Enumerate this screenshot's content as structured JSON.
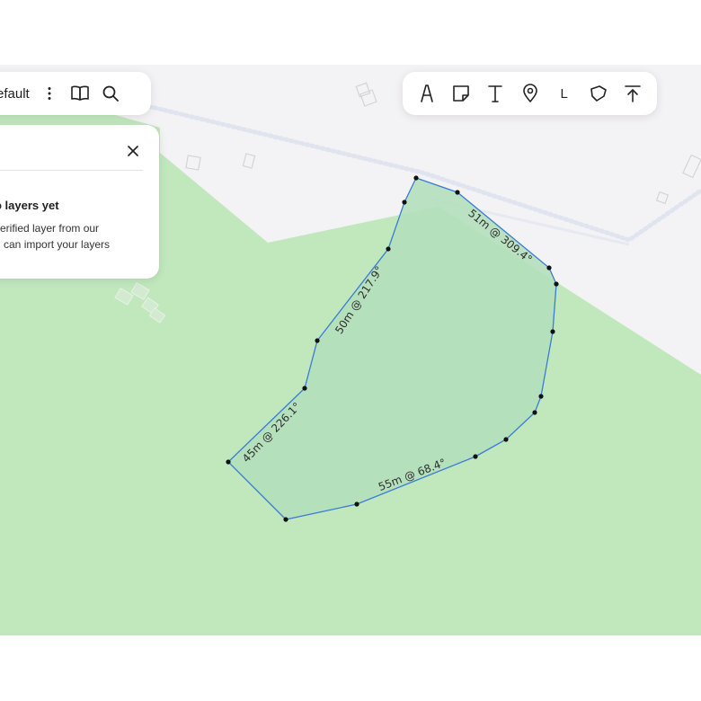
{
  "layer_toolbar": {
    "layer_name": "efault",
    "icons": [
      "more-vertical-icon",
      "book-open-icon",
      "search-icon"
    ]
  },
  "draw_toolbar": {
    "tools": [
      {
        "name": "text-tool-icon"
      },
      {
        "name": "sticky-note-icon"
      },
      {
        "name": "text-t-icon"
      },
      {
        "name": "map-pin-icon"
      },
      {
        "name": "line-tool",
        "label": "L"
      },
      {
        "name": "polygon-icon"
      },
      {
        "name": "upload-arrow-icon"
      }
    ]
  },
  "layers_panel": {
    "heading": "o layers yet",
    "line1": "verified layer from our",
    "line2": "u can import your layers"
  },
  "map": {
    "colors": {
      "background": "#f3f2f4",
      "vegetation": "#c1e8bd",
      "polygon_fill": "#b4dfbb",
      "polygon_stroke": "#3a7bd5",
      "road": "#dfe4ef"
    },
    "measurements": [
      {
        "text": "51m @ 309.4°"
      },
      {
        "text": "50m @ 217.9°"
      },
      {
        "text": "45m @ 226.1°"
      },
      {
        "text": "55m @ 68.4°"
      }
    ]
  }
}
